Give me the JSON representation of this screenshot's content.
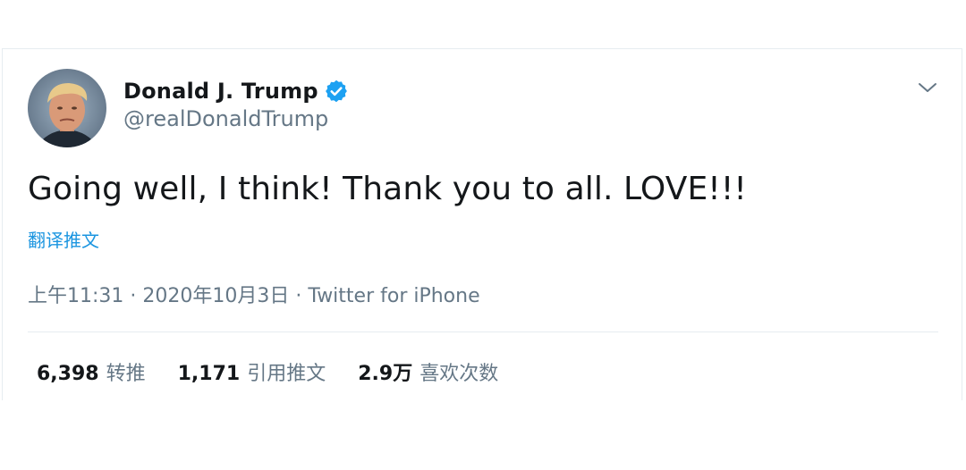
{
  "tweet": {
    "author": {
      "display_name": "Donald J. Trump",
      "handle": "@realDonaldTrump",
      "verified": true
    },
    "text": "Going well, I think! Thank you to all. LOVE!!!",
    "translate_label": "翻译推文",
    "time": "上午11:31",
    "separator": "·",
    "date": "2020年10月3日",
    "source": "Twitter for iPhone",
    "stats": {
      "retweets": {
        "count": "6,398",
        "label": "转推"
      },
      "quotes": {
        "count": "1,171",
        "label": "引用推文"
      },
      "likes": {
        "count": "2.9万",
        "label": "喜欢次数"
      }
    }
  },
  "colors": {
    "accent": "#1b95e0",
    "verified": "#1da1f2",
    "text_primary": "#14171a",
    "text_secondary": "#657786",
    "divider": "#e6ecf0"
  },
  "icons": {
    "verified": "verified-badge-icon",
    "menu": "chevron-down-icon"
  }
}
